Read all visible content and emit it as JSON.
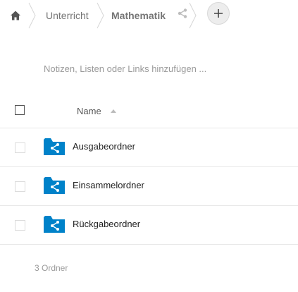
{
  "breadcrumb": {
    "items": [
      "Unterricht",
      "Mathematik"
    ]
  },
  "notes": {
    "placeholder": "Notizen, Listen oder Links hinzufügen ..."
  },
  "table": {
    "name_header": "Name",
    "sort": "ascending",
    "rows": [
      {
        "name": "Ausgabeordner",
        "icon": "shared-folder-icon"
      },
      {
        "name": "Einsammelordner",
        "icon": "shared-folder-icon"
      },
      {
        "name": "Rückgabeordner",
        "icon": "shared-folder-icon"
      }
    ]
  },
  "summary": "3 Ordner",
  "colors": {
    "accent": "#0082c9",
    "muted": "#767676"
  }
}
